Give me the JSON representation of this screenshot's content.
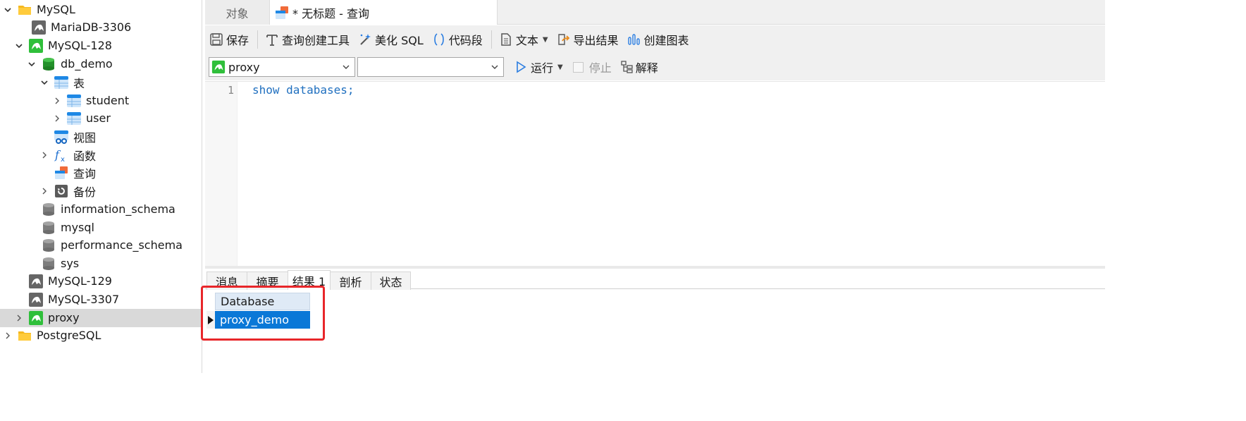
{
  "sidebar": {
    "items": [
      {
        "label": "MySQL",
        "icon": "folder-icon"
      },
      {
        "label": "MariaDB-3306",
        "icon": "mysql-connection-icon"
      },
      {
        "label": "MySQL-128",
        "icon": "mysql-connection-active-icon"
      },
      {
        "label": "db_demo",
        "icon": "database-active-icon"
      },
      {
        "label": "表",
        "icon": "table-group-icon"
      },
      {
        "label": "student",
        "icon": "table-icon"
      },
      {
        "label": "user",
        "icon": "table-icon"
      },
      {
        "label": "视图",
        "icon": "view-icon"
      },
      {
        "label": "函数",
        "icon": "function-icon"
      },
      {
        "label": "查询",
        "icon": "query-icon"
      },
      {
        "label": "备份",
        "icon": "backup-icon"
      },
      {
        "label": "information_schema",
        "icon": "database-icon"
      },
      {
        "label": "mysql",
        "icon": "database-icon"
      },
      {
        "label": "performance_schema",
        "icon": "database-icon"
      },
      {
        "label": "sys",
        "icon": "database-icon"
      },
      {
        "label": "MySQL-129",
        "icon": "mysql-connection-icon"
      },
      {
        "label": "MySQL-3307",
        "icon": "mysql-connection-icon"
      },
      {
        "label": "proxy",
        "icon": "mysql-connection-active-icon"
      },
      {
        "label": "PostgreSQL",
        "icon": "folder-icon"
      }
    ]
  },
  "tabs": {
    "objects_label": "对象",
    "query_label": "* 无标题 - 查询"
  },
  "toolbar": {
    "save_label": "保存",
    "query_builder_label": "查询创建工具",
    "beautify_label": "美化 SQL",
    "snippet_label": "代码段",
    "text_label": "文本",
    "export_label": "导出结果",
    "chart_label": "创建图表"
  },
  "selectors": {
    "connection_value": "proxy",
    "database_value": "",
    "run_label": "运行",
    "stop_label": "停止",
    "explain_label": "解释"
  },
  "editor": {
    "line_number": "1",
    "code": "show databases;"
  },
  "results": {
    "tabs": [
      "消息",
      "摘要",
      "结果 1",
      "剖析",
      "状态"
    ],
    "active_tab": "结果 1",
    "columns": [
      "Database"
    ],
    "rows": [
      [
        "proxy_demo"
      ]
    ]
  },
  "colors": {
    "selection_blue": "#0a78d7",
    "highlight_red": "#e8262a",
    "mysql_green": "#2fbf3a",
    "code_blue": "#1f6fbf"
  }
}
